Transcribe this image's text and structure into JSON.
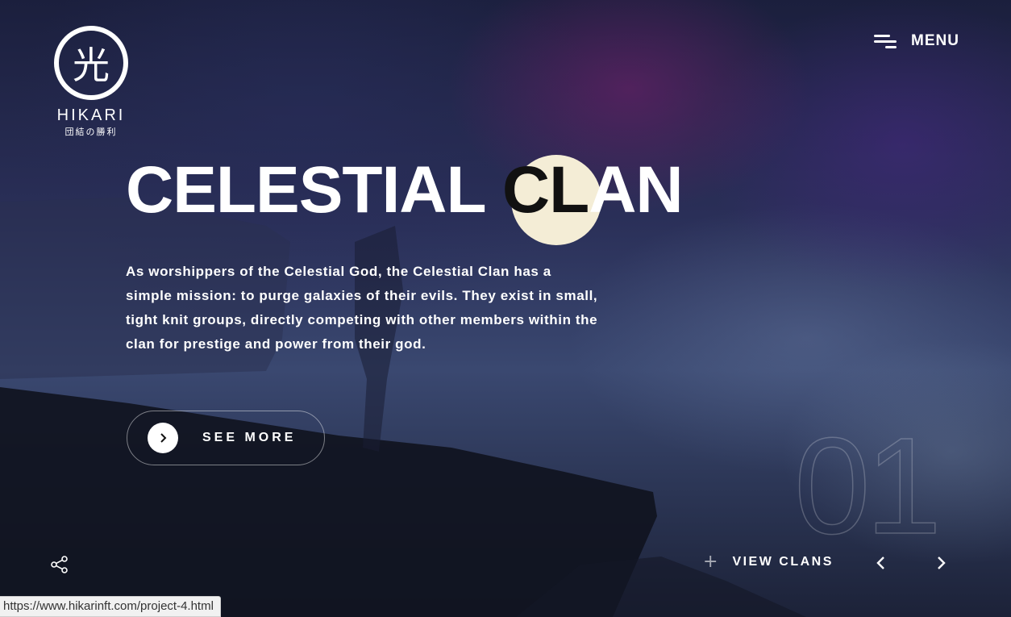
{
  "logo": {
    "glyph": "光",
    "name": "HIKARI",
    "subtitle": "団結の勝利"
  },
  "menu": {
    "label": "MENU",
    "icon": "hamburger-menu-icon"
  },
  "hero": {
    "title_main": "CELESTIAL ",
    "title_accent": "CL",
    "title_rest": "AN",
    "description": "As worshippers of the Celestial God, the Celestial Clan has a simple mission: to purge galaxies of their evils. They exist in small, tight knit groups, directly competing with other members within the clan for prestige and power from their god.",
    "cta_label": "SEE MORE",
    "cta_icon": "chevron-right-icon",
    "slide_number": "01"
  },
  "footer": {
    "share_icon": "share-icon",
    "view_plus": "+",
    "view_label": "VIEW CLANS",
    "prev_icon": "chevron-left-icon",
    "next_icon": "chevron-right-icon"
  },
  "status_bar": {
    "url": "https://www.hikarinft.com/project-4.html"
  },
  "colors": {
    "moon": "#f4edd6",
    "accent_text": "#111111",
    "background": "#1b1f3d"
  }
}
